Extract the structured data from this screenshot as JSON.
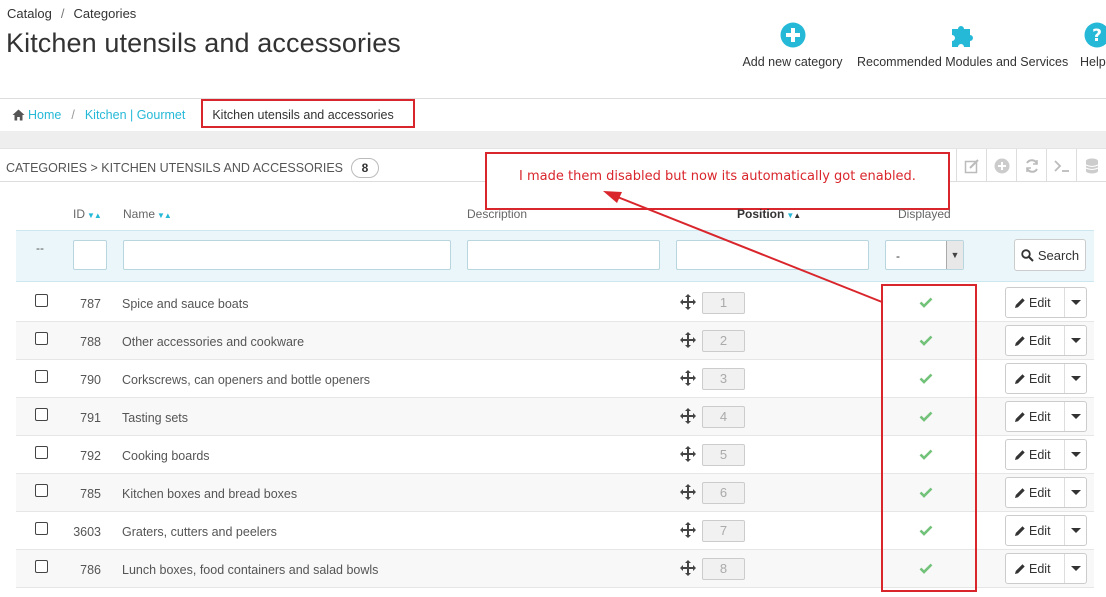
{
  "header": {
    "breadcrumb": [
      "Catalog",
      "Categories"
    ],
    "title": "Kitchen utensils and accessories"
  },
  "toolbar": {
    "add_label": "Add new category",
    "modules_label": "Recommended Modules and Services",
    "help_label": "Help"
  },
  "breadcrumb2": {
    "home": "Home",
    "parent": "Kitchen | Gourmet",
    "current": "Kitchen utensils and accessories"
  },
  "panel": {
    "heading": "CATEGORIES > KITCHEN UTENSILS AND ACCESSORIES",
    "count": "8"
  },
  "annotation": "I made them disabled but now its automatically got enabled.",
  "columns": {
    "id": "ID",
    "name": "Name",
    "description": "Description",
    "position": "Position",
    "displayed": "Displayed"
  },
  "filters": {
    "dash": "--",
    "displayed_value": "-",
    "search_label": "Search"
  },
  "rows": [
    {
      "id": "787",
      "name": "Spice and sauce boats",
      "position": "1"
    },
    {
      "id": "788",
      "name": "Other accessories and cookware",
      "position": "2"
    },
    {
      "id": "790",
      "name": "Corkscrews, can openers and bottle openers",
      "position": "3"
    },
    {
      "id": "791",
      "name": "Tasting sets",
      "position": "4"
    },
    {
      "id": "792",
      "name": "Cooking boards",
      "position": "5"
    },
    {
      "id": "785",
      "name": "Kitchen boxes and bread boxes",
      "position": "6"
    },
    {
      "id": "3603",
      "name": "Graters, cutters and peelers",
      "position": "7"
    },
    {
      "id": "786",
      "name": "Lunch boxes, food containers and salad bowls",
      "position": "8"
    }
  ],
  "edit_label": "Edit",
  "colors": {
    "accent": "#25b9d7",
    "annotation_red": "#d9262c",
    "check_green": "#72c279"
  }
}
